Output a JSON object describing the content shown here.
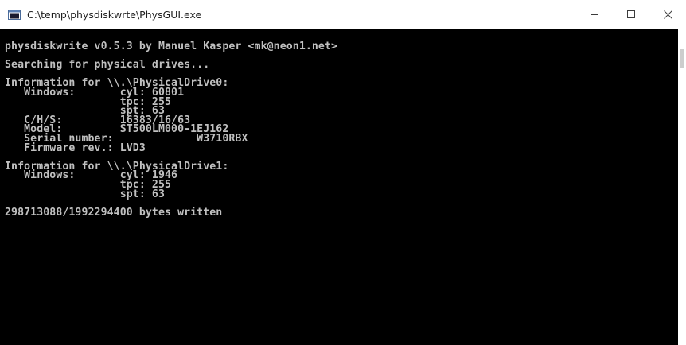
{
  "window": {
    "title": "C:\\temp\\physdiskwrte\\PhysGUI.exe",
    "icon": "console-app-icon",
    "buttons": {
      "minimize": "minimize-icon",
      "maximize": "maximize-icon",
      "close": "close-icon"
    }
  },
  "console": {
    "background": "#000000",
    "foreground": "#c0c0c0",
    "lines": [
      "physdiskwrite v0.5.3 by Manuel Kasper <mk@neon1.net>",
      "",
      "Searching for physical drives...",
      "",
      "Information for \\\\.\\PhysicalDrive0:",
      "   Windows:       cyl: 60801",
      "                  tpc: 255",
      "                  spt: 63",
      "   C/H/S:         16383/16/63",
      "   Model:         ST500LM000-1EJ162",
      "   Serial number:             W3710RBX",
      "   Firmware rev.: LVD3",
      "",
      "Information for \\\\.\\PhysicalDrive1:",
      "   Windows:       cyl: 1946",
      "                  tpc: 255",
      "                  spt: 63",
      "",
      "298713088/1992294400 bytes written"
    ]
  }
}
